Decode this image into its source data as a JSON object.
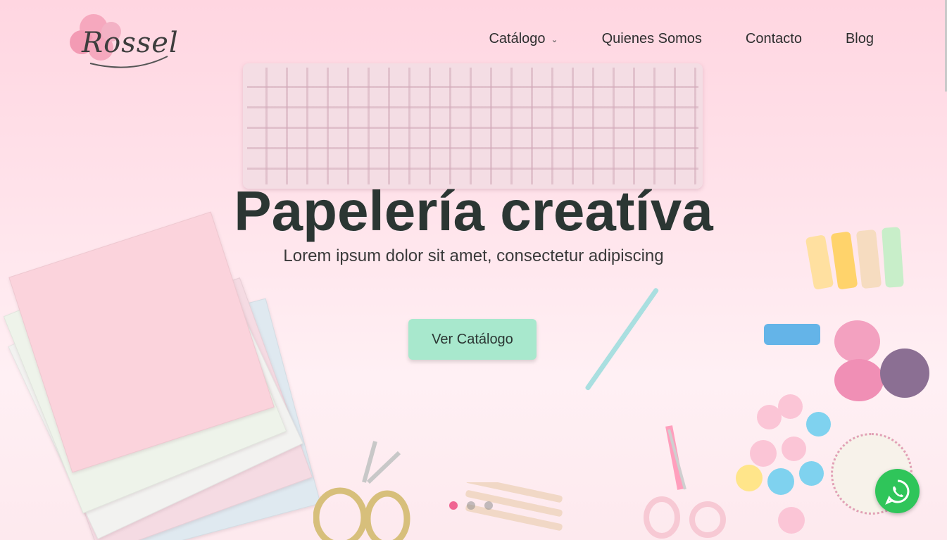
{
  "brand": {
    "logo_text": "Rossel"
  },
  "nav": {
    "items": [
      {
        "label": "Catálogo",
        "has_dropdown": true
      },
      {
        "label": "Quienes Somos"
      },
      {
        "label": "Contacto"
      },
      {
        "label": "Blog"
      }
    ]
  },
  "hero": {
    "title": "Papelería creatíva",
    "subtitle": "Lorem ipsum dolor sit amet, consectetur adipiscing",
    "cta_label": "Ver Catálogo"
  },
  "slider": {
    "total": 3,
    "active_index": 0
  },
  "colors": {
    "background": "#ffd6e1",
    "cta": "#a8e8cd",
    "text_dark": "#2b3633",
    "active_dot": "#f06592",
    "whatsapp": "#2fc55a"
  },
  "icons": {
    "dropdown": "chevron-down-icon",
    "whatsapp": "whatsapp-icon"
  }
}
